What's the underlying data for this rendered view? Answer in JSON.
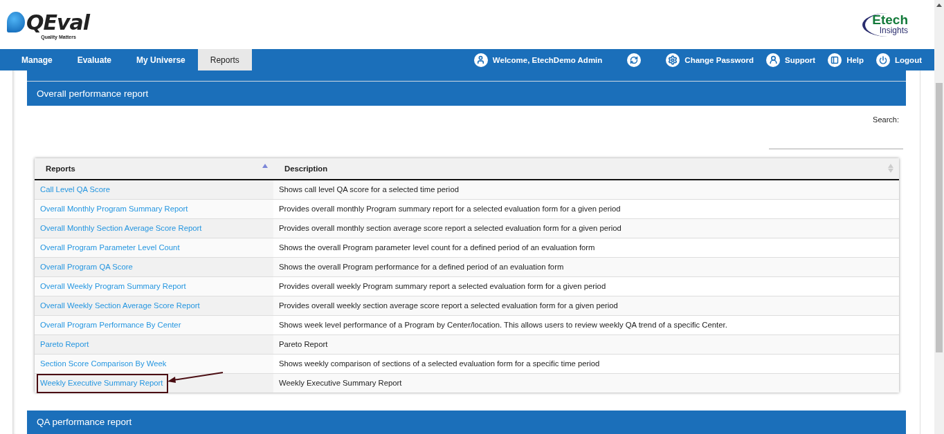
{
  "logo": {
    "name": "QEval",
    "tagline": "Quality Matters"
  },
  "partner_logo": {
    "name": "Etech",
    "subtitle": "Insights"
  },
  "nav": {
    "items": [
      {
        "label": "Manage",
        "selected": false
      },
      {
        "label": "Evaluate",
        "selected": false
      },
      {
        "label": "My Universe",
        "selected": false
      },
      {
        "label": "Reports",
        "selected": true
      }
    ],
    "user_links": [
      {
        "kind": "user",
        "label": "Welcome, EtechDemo Admin"
      },
      {
        "kind": "switch"
      },
      {
        "kind": "settings",
        "label": "Change Password"
      },
      {
        "kind": "support",
        "label": "Support"
      },
      {
        "kind": "help",
        "label": "Help"
      },
      {
        "kind": "logout",
        "label": "Logout"
      }
    ]
  },
  "section": {
    "title": "Overall performance report",
    "search": {
      "label": "Search:"
    },
    "table": {
      "columns": [
        {
          "label": "Reports",
          "sorted": true
        },
        {
          "label": "Description",
          "sorted": false
        }
      ],
      "rows": [
        {
          "report": "Call Level QA Score",
          "description": "Shows call level QA score for a selected time period",
          "highlighted": false
        },
        {
          "report": "Overall Monthly Program Summary Report",
          "description": "Provides overall monthly Program summary report for a selected evaluation form for a given period",
          "highlighted": false
        },
        {
          "report": "Overall Monthly Section Average Score Report",
          "description": "Provides overall monthly section average score report a selected evaluation form for a given period",
          "highlighted": false
        },
        {
          "report": "Overall Program Parameter Level Count",
          "description": "Shows the overall Program parameter level count for a defined period of an evaluation form",
          "highlighted": false
        },
        {
          "report": "Overall Program QA Score",
          "description": "Shows the overall Program performance for a defined period of an evaluation form",
          "highlighted": false
        },
        {
          "report": "Overall Weekly Program Summary Report",
          "description": "Provides overall weekly Program summary report a selected evaluation form for a given period",
          "highlighted": false
        },
        {
          "report": "Overall Weekly Section Average Score Report",
          "description": "Provides overall weekly section average score report a selected evaluation form for a given period",
          "highlighted": false
        },
        {
          "report": "Overall Program Performance By Center",
          "description": "Shows week level performance of a Program by Center/location. This allows users to review weekly QA trend of a specific Center.",
          "highlighted": false
        },
        {
          "report": "Pareto Report",
          "description": "Pareto Report",
          "highlighted": false
        },
        {
          "report": "Section Score Comparison By Week",
          "description": "Shows weekly comparison of sections of a selected evaluation form for a specific time period",
          "highlighted": false
        },
        {
          "report": "Weekly Executive Summary Report",
          "description": "Weekly Executive Summary Report",
          "highlighted": true
        }
      ]
    }
  },
  "next_section": {
    "title": "QA performance report"
  }
}
